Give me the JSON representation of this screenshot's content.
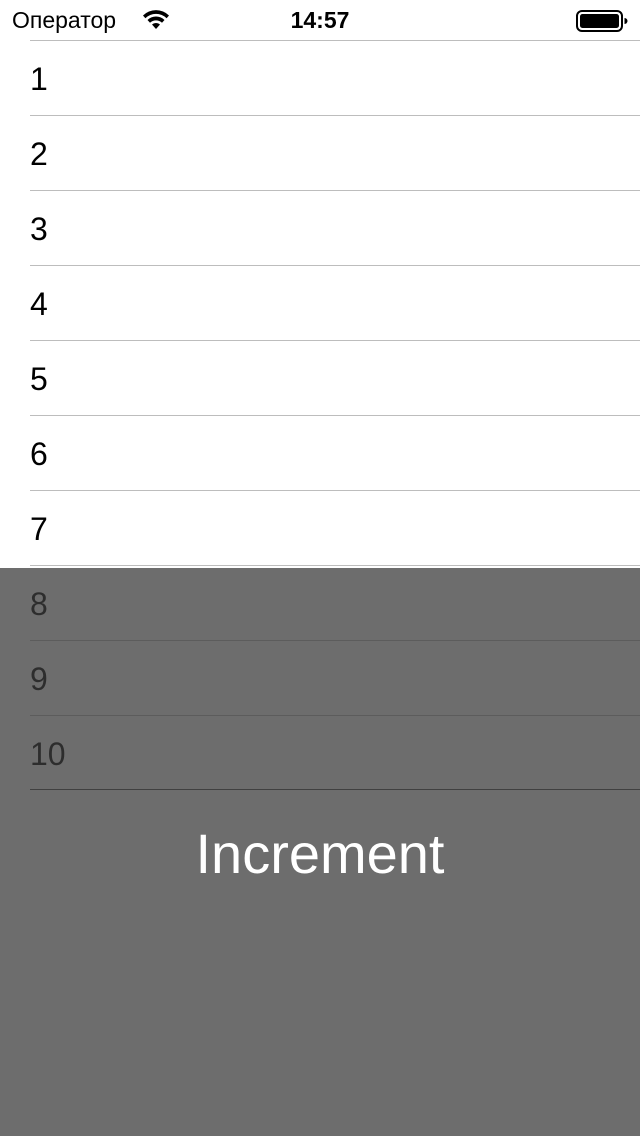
{
  "status_bar": {
    "carrier": "Оператор",
    "time": "14:57",
    "wifi_icon": "wifi-icon",
    "battery_icon": "battery-full-icon"
  },
  "list": {
    "rows": [
      {
        "label": "1"
      },
      {
        "label": "2"
      },
      {
        "label": "3"
      },
      {
        "label": "4"
      },
      {
        "label": "5"
      },
      {
        "label": "6"
      },
      {
        "label": "7"
      },
      {
        "label": "8"
      },
      {
        "label": "9"
      },
      {
        "label": "10"
      }
    ]
  },
  "overlay": {
    "button_label": "Increment",
    "text_color": "#ffffff"
  }
}
